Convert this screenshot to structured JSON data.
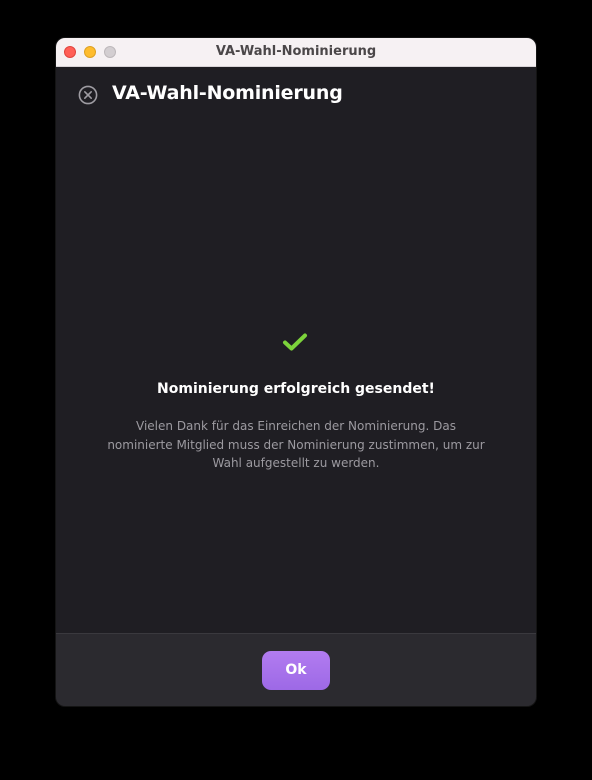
{
  "window": {
    "title": "VA-Wahl-Nominierung"
  },
  "header": {
    "title": "VA-Wahl-Nominierung",
    "close_icon": "close-circle-icon"
  },
  "message": {
    "icon": "checkmark-icon",
    "title": "Nominierung erfolgreich gesendet!",
    "text": "Vielen Dank für das Einreichen der Nominierung. Das nominierte Mitglied muss der Nominierung zustimmen, um zur Wahl aufgestellt zu werden."
  },
  "footer": {
    "ok_label": "Ok"
  },
  "colors": {
    "accent": "#a674ec",
    "success": "#7cd33b",
    "background": "#1f1e23",
    "footer": "#2b2a2f"
  }
}
